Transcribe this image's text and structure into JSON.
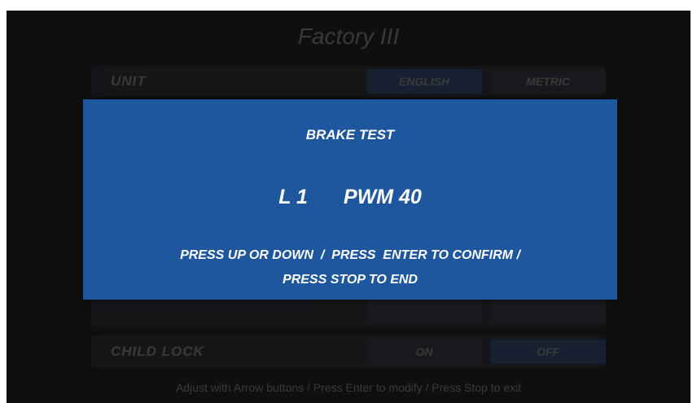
{
  "background_menu": {
    "title": "Factory III",
    "rows": [
      {
        "label": "UNIT",
        "options": [
          "ENGLISH",
          "METRIC"
        ],
        "selected": 0
      },
      {
        "label": "",
        "options": [
          "",
          ""
        ],
        "selected": -1
      },
      {
        "label": "CHILD LOCK",
        "options": [
          "ON",
          "OFF"
        ],
        "selected": 1
      }
    ],
    "hint": "Adjust with Arrow buttons / Press Enter to modify / Press Stop to exit"
  },
  "dialog": {
    "title": "BRAKE TEST",
    "level": "L 1",
    "pwm": "PWM 40",
    "instruction_line1": "PRESS UP OR DOWN  /  PRESS  ENTER TO CONFIRM /",
    "instruction_line2": "PRESS STOP TO END"
  },
  "colors": {
    "screen_bg": "#0f0f10",
    "dialog_bg": "#1f579e",
    "dialog_text": "#ffffff"
  }
}
